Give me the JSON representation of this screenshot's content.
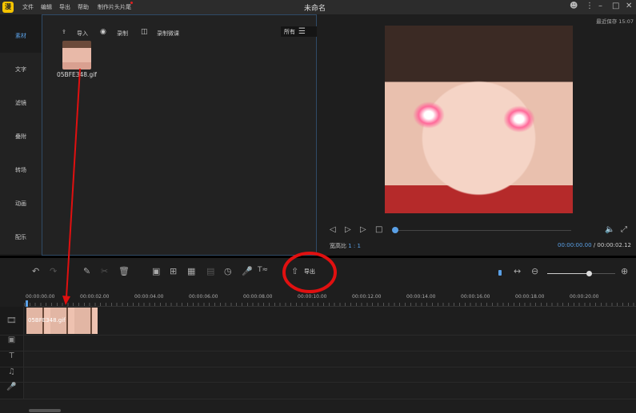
{
  "app": {
    "logo": "漫",
    "title": "未命名",
    "saved": "最近保存 15:07"
  },
  "menu": [
    "文件",
    "编辑",
    "导出",
    "帮助",
    "制作片头片尾"
  ],
  "tabs": [
    "素材",
    "文字",
    "滤镜",
    "叠附",
    "转场",
    "动画",
    "配乐"
  ],
  "media": {
    "import": "导入",
    "record": "录制",
    "record_lesson": "录制微课",
    "filter": "所有",
    "file": "05BFE348.gif"
  },
  "preview": {
    "ratio_label": "宽高比",
    "ratio": "1 : 1",
    "current": "00:00:00.00",
    "sep": "/",
    "total": "00:00:02.12",
    "progress": 0
  },
  "toolbar": {
    "export": "导出",
    "zoom_level": 0.8
  },
  "ruler": [
    "00:00:00.00",
    "00:00:02.00",
    "00:00:04.00",
    "00:00:06.00",
    "00:00:08.00",
    "00:00:10.00",
    "00:00:12.00",
    "00:00:14.00",
    "00:00:16.00",
    "00:00:18.00",
    "00:00:20.00"
  ],
  "clip": {
    "label": "05BFE348.gif"
  },
  "colors": {
    "accent": "#5aa0e6",
    "annotation": "#e01010"
  }
}
